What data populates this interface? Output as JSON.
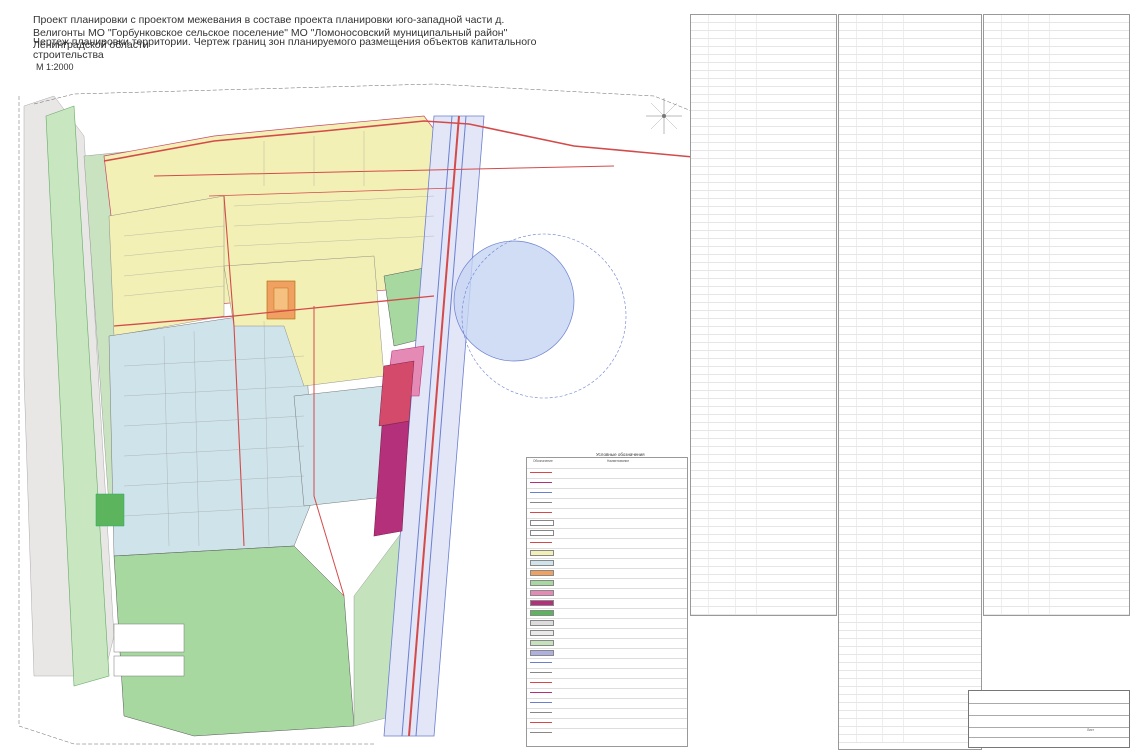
{
  "header": {
    "title": "Проект планировки с проектом межевания в составе проекта планировки  юго-западной части д. Велигонты МО \"Горбунковское сельское поселение\" МО \"Ломоносовский муниципальный район\" Ленинградской области",
    "subtitle": "Чертеж планировки территории. Чертеж границ зон планируемого размещения объектов капитального строительства",
    "scale": "М 1:2000"
  },
  "colors": {
    "residential_yellow": "#f3f0b6",
    "individual_blue": "#cfe3ea",
    "green_zone": "#a6d8a0",
    "green_dark": "#5cb55c",
    "social_orange": "#f0a060",
    "road_red": "#d44a4a",
    "magenta": "#b5307a",
    "pink": "#e58ab5",
    "rail_blue": "#6a7fd0",
    "grey_lines": "#888888"
  },
  "legend": {
    "title": "Условные обозначения",
    "col_symbol": "Обозначение",
    "col_name": "Наименование"
  },
  "stamp": {
    "label": "Лист"
  }
}
